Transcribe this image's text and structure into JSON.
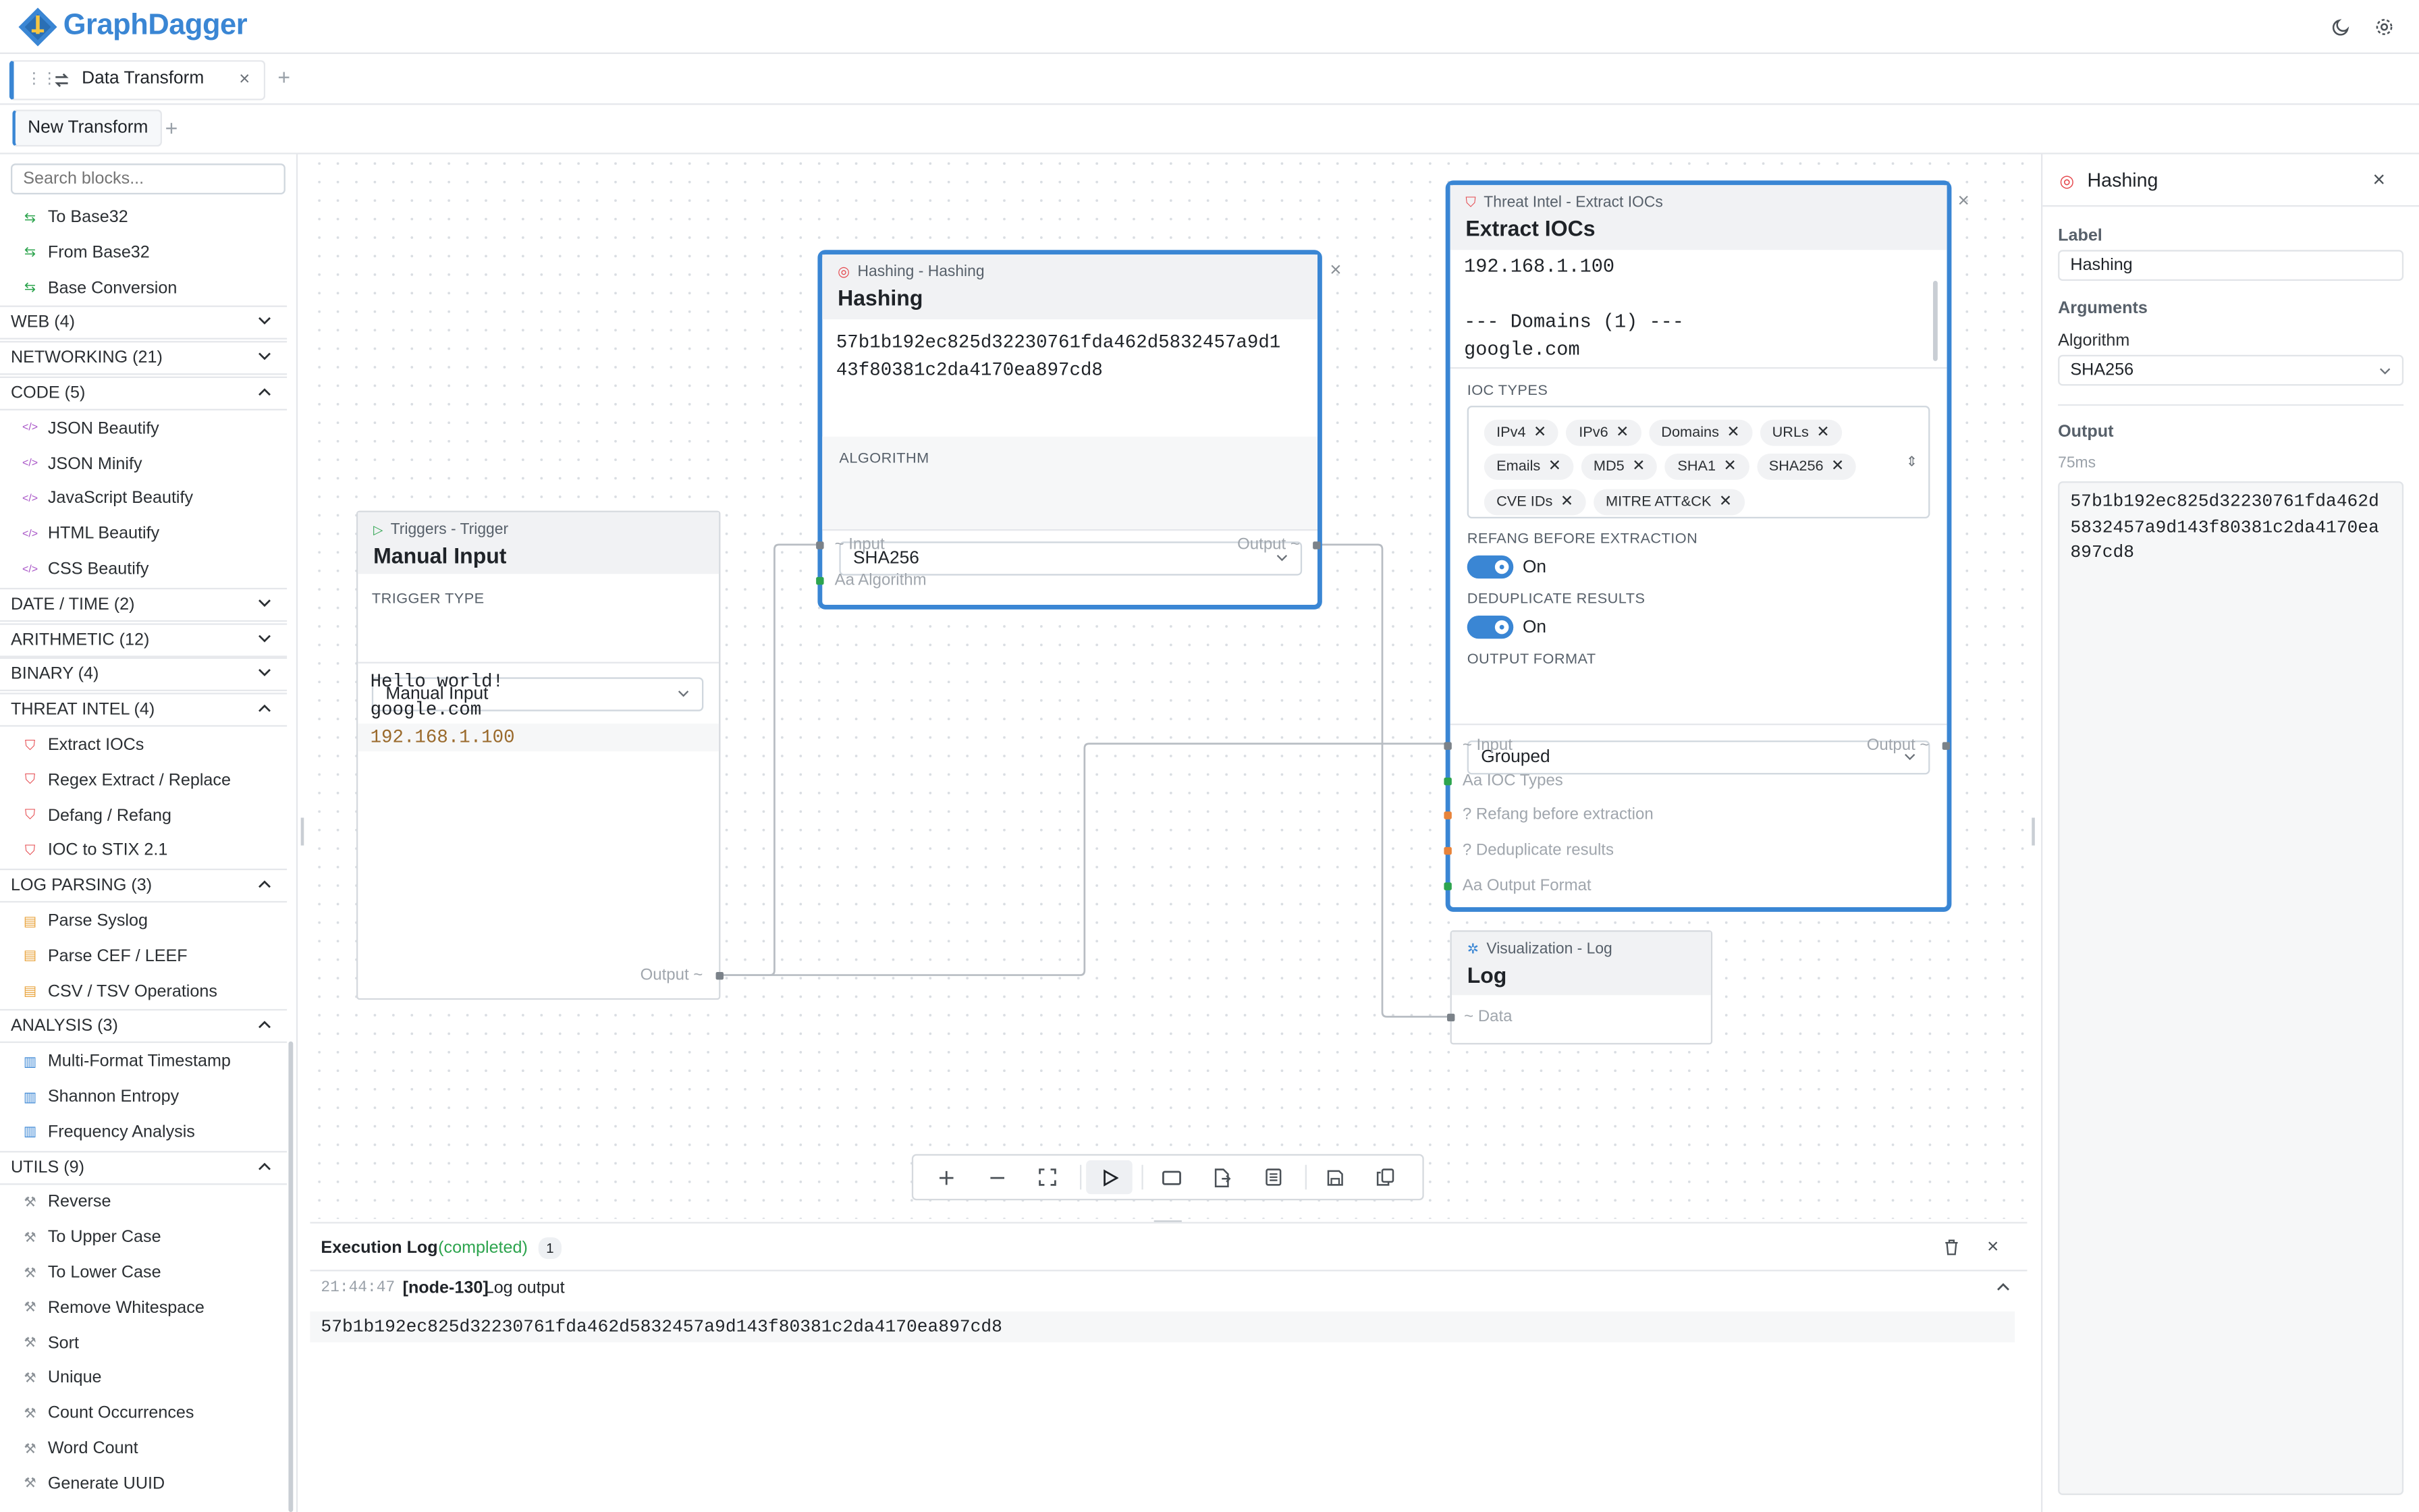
{
  "app": {
    "name": "GraphDagger"
  },
  "workspace_tabs": [
    {
      "label": "Data Transform"
    }
  ],
  "transform_tabs": [
    {
      "label": "New Transform"
    }
  ],
  "sidebar": {
    "search_placeholder": "Search blocks...",
    "rows": [
      {
        "kind": "item",
        "label": "To Base32",
        "icon": "transform-icon",
        "color": "#2da44e"
      },
      {
        "kind": "item",
        "label": "From Base32",
        "icon": "transform-icon",
        "color": "#2da44e"
      },
      {
        "kind": "item",
        "label": "Base Conversion",
        "icon": "transform-icon",
        "color": "#2da44e"
      },
      {
        "kind": "cat",
        "label": "WEB (4)",
        "open": false
      },
      {
        "kind": "cat",
        "label": "NETWORKING (21)",
        "open": false
      },
      {
        "kind": "cat",
        "label": "CODE (5)",
        "open": true
      },
      {
        "kind": "item",
        "label": "JSON Beautify",
        "icon": "code-icon",
        "color": "#a855c7"
      },
      {
        "kind": "item",
        "label": "JSON Minify",
        "icon": "code-icon",
        "color": "#a855c7"
      },
      {
        "kind": "item",
        "label": "JavaScript Beautify",
        "icon": "code-icon",
        "color": "#a855c7"
      },
      {
        "kind": "item",
        "label": "HTML Beautify",
        "icon": "code-icon",
        "color": "#a855c7"
      },
      {
        "kind": "item",
        "label": "CSS Beautify",
        "icon": "code-icon",
        "color": "#a855c7"
      },
      {
        "kind": "cat",
        "label": "DATE / TIME (2)",
        "open": false
      },
      {
        "kind": "cat",
        "label": "ARITHMETIC (12)",
        "open": false
      },
      {
        "kind": "cat",
        "label": "BINARY (4)",
        "open": false
      },
      {
        "kind": "cat",
        "label": "THREAT INTEL (4)",
        "open": true
      },
      {
        "kind": "item",
        "label": "Extract IOCs",
        "icon": "shield-icon",
        "color": "#e5484d"
      },
      {
        "kind": "item",
        "label": "Regex Extract / Replace",
        "icon": "shield-icon",
        "color": "#e5484d"
      },
      {
        "kind": "item",
        "label": "Defang / Refang",
        "icon": "shield-icon",
        "color": "#e5484d"
      },
      {
        "kind": "item",
        "label": "IOC to STIX 2.1",
        "icon": "shield-icon",
        "color": "#e5484d"
      },
      {
        "kind": "cat",
        "label": "LOG PARSING (3)",
        "open": true
      },
      {
        "kind": "item",
        "label": "Parse Syslog",
        "icon": "file-icon",
        "color": "#e8a23a"
      },
      {
        "kind": "item",
        "label": "Parse CEF / LEEF",
        "icon": "file-icon",
        "color": "#e8a23a"
      },
      {
        "kind": "item",
        "label": "CSV / TSV Operations",
        "icon": "file-icon",
        "color": "#e8a23a"
      },
      {
        "kind": "cat",
        "label": "ANALYSIS (3)",
        "open": true
      },
      {
        "kind": "item",
        "label": "Multi-Format Timestamp",
        "icon": "bar-chart-icon",
        "color": "#3a86d4"
      },
      {
        "kind": "item",
        "label": "Shannon Entropy",
        "icon": "bar-chart-icon",
        "color": "#3a86d4"
      },
      {
        "kind": "item",
        "label": "Frequency Analysis",
        "icon": "bar-chart-icon",
        "color": "#3a86d4"
      },
      {
        "kind": "cat",
        "label": "UTILS (9)",
        "open": true
      },
      {
        "kind": "item",
        "label": "Reverse",
        "icon": "wrench-icon",
        "color": "#8a9096"
      },
      {
        "kind": "item",
        "label": "To Upper Case",
        "icon": "wrench-icon",
        "color": "#8a9096"
      },
      {
        "kind": "item",
        "label": "To Lower Case",
        "icon": "wrench-icon",
        "color": "#8a9096"
      },
      {
        "kind": "item",
        "label": "Remove Whitespace",
        "icon": "wrench-icon",
        "color": "#8a9096"
      },
      {
        "kind": "item",
        "label": "Sort",
        "icon": "wrench-icon",
        "color": "#8a9096"
      },
      {
        "kind": "item",
        "label": "Unique",
        "icon": "wrench-icon",
        "color": "#8a9096"
      },
      {
        "kind": "item",
        "label": "Count Occurrences",
        "icon": "wrench-icon",
        "color": "#8a9096"
      },
      {
        "kind": "item",
        "label": "Word Count",
        "icon": "wrench-icon",
        "color": "#8a9096"
      },
      {
        "kind": "item",
        "label": "Generate UUID",
        "icon": "wrench-icon",
        "color": "#8a9096"
      }
    ]
  },
  "nodes": {
    "manual_input": {
      "subtitle": "Triggers - Trigger",
      "title": "Manual Input",
      "trigger_type_label": "TRIGGER TYPE",
      "trigger_type_value": "Manual Input",
      "content_lines": [
        "Hello world!",
        "google.com",
        "192.168.1.100"
      ],
      "output_port": "Output ~"
    },
    "hashing": {
      "subtitle": "Hashing - Hashing",
      "title": "Hashing",
      "output_lines": [
        "57b1b192ec825d32230761fda462d5832457a9d1",
        "43f80381c2da4170ea897cd8"
      ],
      "algorithm_label": "ALGORITHM",
      "algorithm_value": "SHA256",
      "input_port": "~ Input",
      "output_port": "Output ~",
      "algorithm_port": "Aa Algorithm"
    },
    "extract_iocs": {
      "subtitle": "Threat Intel - Extract IOCs",
      "title": "Extract IOCs",
      "output_lines": [
        "192.168.1.100",
        "",
        "--- Domains (1) ---",
        "google.com"
      ],
      "ioc_types_label": "IOC TYPES",
      "ioc_types": [
        [
          "IPv4",
          "IPv6",
          "Domains",
          "URLs"
        ],
        [
          "Emails",
          "MD5",
          "SHA1",
          "SHA256"
        ],
        [
          "CVE IDs",
          "MITRE ATT&CK"
        ]
      ],
      "refang_label": "REFANG BEFORE EXTRACTION",
      "refang_value": "On",
      "dedup_label": "DEDUPLICATE RESULTS",
      "dedup_value": "On",
      "format_label": "OUTPUT FORMAT",
      "format_value": "Grouped",
      "ports": {
        "input": "~ Input",
        "output": "Output ~",
        "ioc_types": "Aa IOC Types",
        "refang": "? Refang before extraction",
        "dedup": "? Deduplicate results",
        "format": "Aa Output Format"
      }
    },
    "log": {
      "subtitle": "Visualization - Log",
      "title": "Log",
      "data_port": "~ Data"
    }
  },
  "toolbar": {
    "buttons": [
      "plus-icon",
      "minus-icon",
      "fit-view-icon",
      "play-icon",
      "rectangle-icon",
      "file-export-icon",
      "document-icon",
      "save-icon",
      "copy-icon"
    ]
  },
  "exec_log": {
    "title": "Execution Log",
    "status": "(completed)",
    "count": "1",
    "entry": {
      "time": "21:44:47",
      "node": "[node-130]",
      "message": "Log output",
      "output": "57b1b192ec825d32230761fda462d5832457a9d143f80381c2da4170ea897cd8"
    }
  },
  "inspector": {
    "title": "Hashing",
    "label_heading": "Label",
    "label_value": "Hashing",
    "arguments_heading": "Arguments",
    "algorithm_heading": "Algorithm",
    "algorithm_value": "SHA256",
    "output_heading": "Output",
    "duration": "75ms",
    "output_lines": [
      "57b1b192ec825d32230761fda462d",
      "5832457a9d143f80381c2da4170ea",
      "897cd8"
    ]
  },
  "colors": {
    "accent": "#3a86d4",
    "ip_highlight": "#9a6a2c"
  }
}
